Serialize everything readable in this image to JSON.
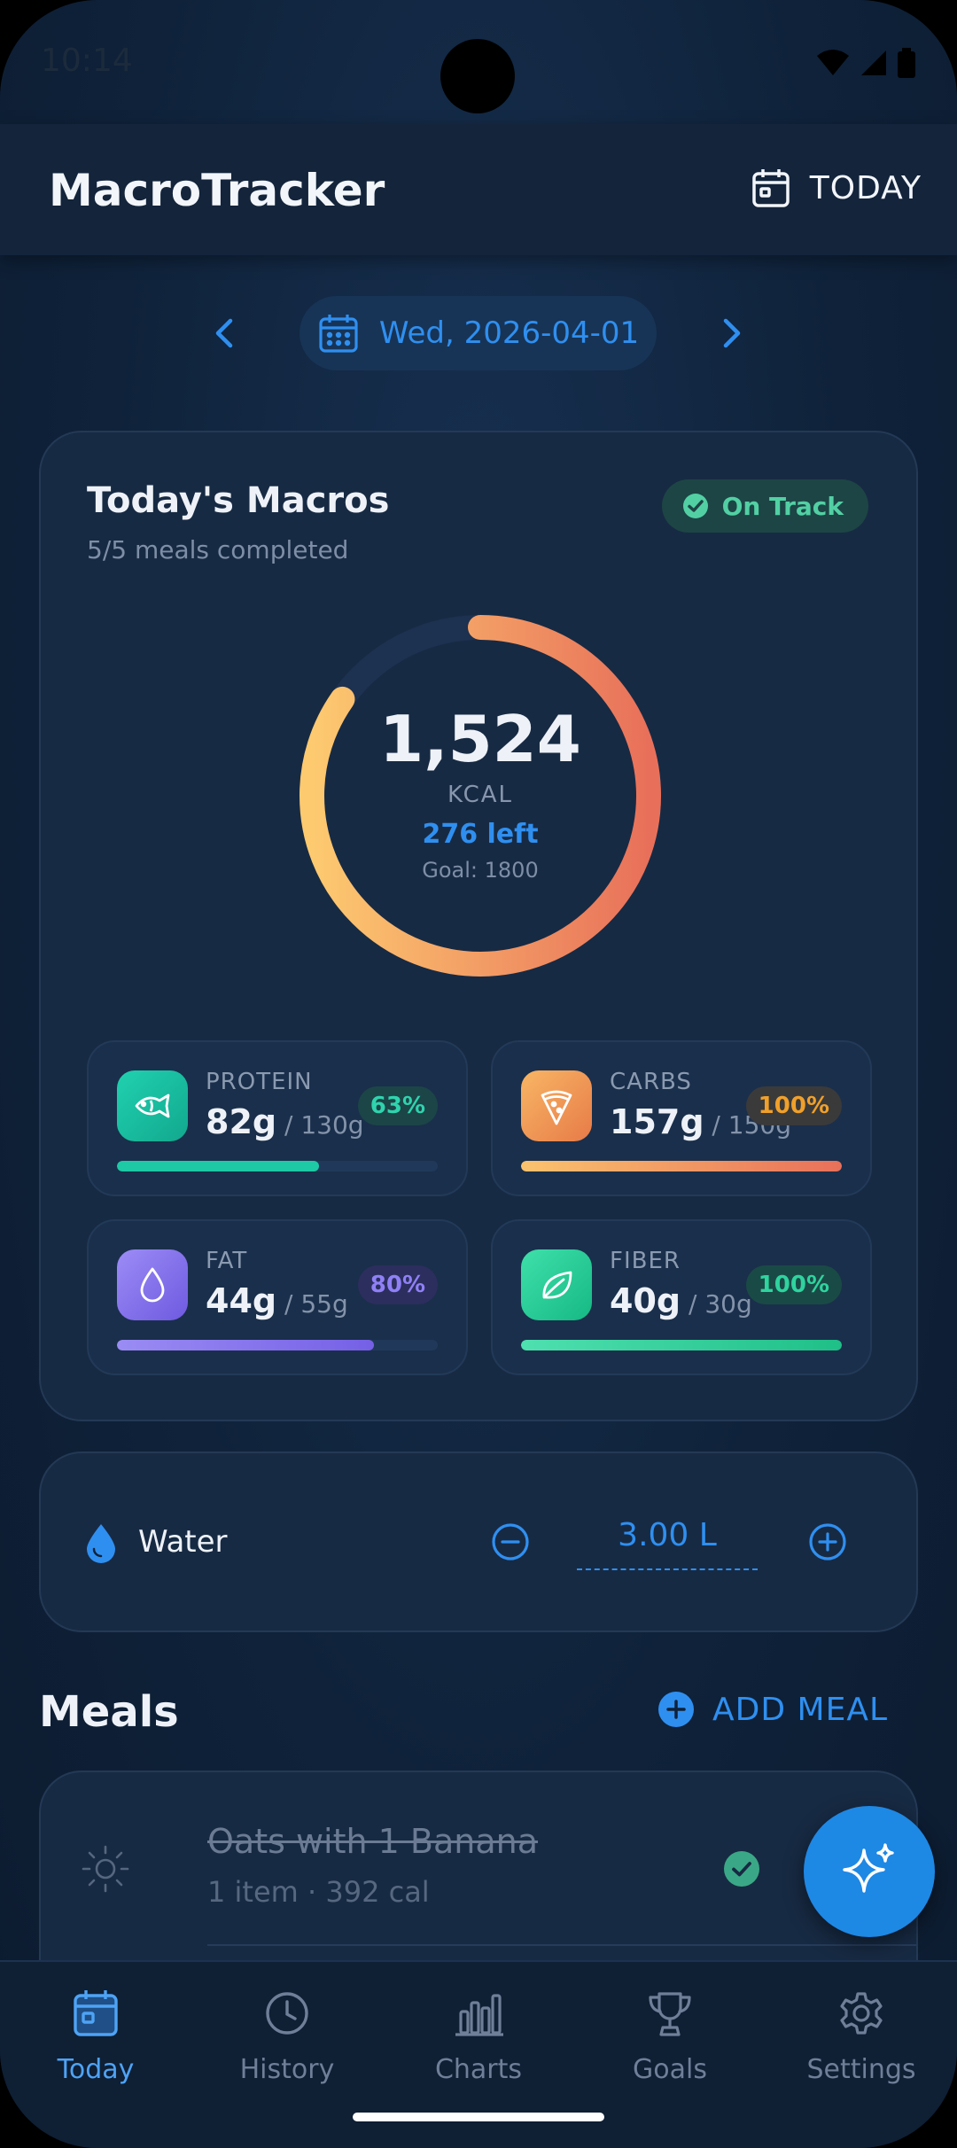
{
  "status_bar": {
    "time": "10:14"
  },
  "app_bar": {
    "title": "MacroTracker",
    "today_label": "TODAY"
  },
  "date_nav": {
    "date": "Wed, 2026-04-01"
  },
  "macros": {
    "title": "Today's Macros",
    "subtitle": "5/5 meals completed",
    "badge": "On Track",
    "calories": "1,524",
    "unit": "KCAL",
    "left": "276 left",
    "goal": "Goal: 1800",
    "progress": 0.847,
    "tiles": [
      {
        "name": "PROTEIN",
        "value": "82g",
        "goal": " / 130g",
        "pct": "63%",
        "fill": 0.63,
        "color": "#1ec9a6"
      },
      {
        "name": "CARBS",
        "value": "157g",
        "goal": " / 150g",
        "pct": "100%",
        "fill": 1.0,
        "color": "#f5a25a"
      },
      {
        "name": "FAT",
        "value": "44g",
        "goal": " / 55g",
        "pct": "80%",
        "fill": 0.8,
        "color": "#8b7cf0"
      },
      {
        "name": "FIBER",
        "value": "40g",
        "goal": " / 30g",
        "pct": "100%",
        "fill": 1.0,
        "color": "#2fd39e"
      }
    ]
  },
  "water": {
    "label": "Water",
    "value": "3.00 L"
  },
  "meals": {
    "title": "Meals",
    "add_label": "ADD MEAL",
    "items": [
      {
        "name": "Oats with 1 Banana",
        "meta": "1 item · 392 cal"
      }
    ]
  },
  "bottom_nav": {
    "items": [
      {
        "label": "Today"
      },
      {
        "label": "History"
      },
      {
        "label": "Charts"
      },
      {
        "label": "Goals"
      },
      {
        "label": "Settings"
      }
    ]
  },
  "icons": {
    "calendar": "calendar-icon",
    "fish": "fish-icon",
    "pizza": "pizza-icon",
    "drop": "drop-icon",
    "leaf": "leaf-icon",
    "sun": "sun-icon",
    "sparkles": "sparkles-icon"
  }
}
